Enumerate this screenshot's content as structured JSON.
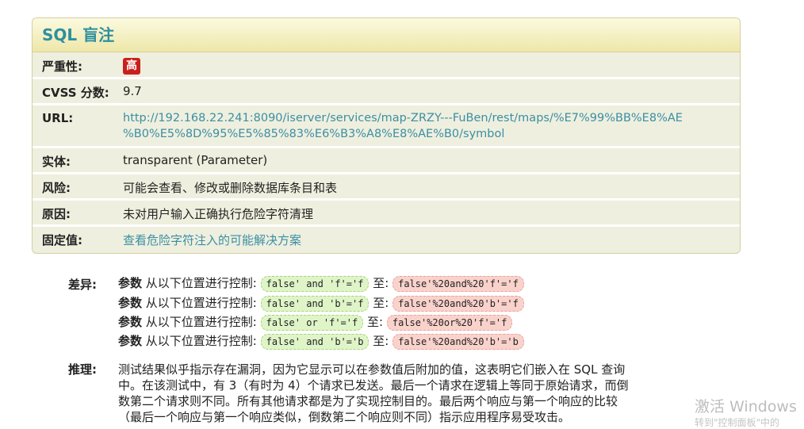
{
  "card": {
    "title": "SQL 盲注",
    "rows": {
      "severity": {
        "label": "严重性:",
        "badge": "高"
      },
      "cvss": {
        "label": "CVSS 分数:",
        "value": "9.7"
      },
      "url": {
        "label": "URL:",
        "line1": "http://192.168.22.241:8090/iserver/services/map-ZRZY---FuBen/rest/maps/%E7%99%BB%E8%AE",
        "line2": "%B0%E5%8D%95%E5%85%83%E6%B3%A8%E8%AE%B0/symbol"
      },
      "entity": {
        "label": "实体:",
        "value": "transparent (Parameter)"
      },
      "risk": {
        "label": "风险:",
        "value": "可能会查看、修改或删除数据库条目和表"
      },
      "cause": {
        "label": "原因:",
        "value": "未对用户输入正确执行危险字符清理"
      },
      "fix": {
        "label": "固定值:",
        "value": "查看危险字符注入的可能解决方案"
      }
    }
  },
  "differences": {
    "label": "差异:",
    "lines": [
      {
        "param": "参数",
        "text": "从以下位置进行控制:",
        "from": "false' and 'f'='f",
        "to_word": "至:",
        "to": "false'%20and%20'f'='f"
      },
      {
        "param": "参数",
        "text": "从以下位置进行控制:",
        "from": "false' and 'b'='f",
        "to_word": "至:",
        "to": "false'%20and%20'b'='f"
      },
      {
        "param": "参数",
        "text": "从以下位置进行控制:",
        "from": "false' or 'f'='f",
        "to_word": "至:",
        "to": "false'%20or%20'f'='f"
      },
      {
        "param": "参数",
        "text": "从以下位置进行控制:",
        "from": "false' and 'b'='b",
        "to_word": "至:",
        "to": "false'%20and%20'b'='b"
      }
    ]
  },
  "reasoning": {
    "label": "推理:",
    "lines": [
      "测试结果似乎指示存在漏洞，因为它显示可以在参数值后附加的值，这表明它们嵌入在 SQL 查询",
      "中。在该测试中，有 3（有时为 4）个请求已发送。最后一个请求在逻辑上等同于原始请求，而倒",
      "数第二个请求则不同。所有其他请求都是为了实现控制目的。最后两个响应与第一个响应的比较",
      "（最后一个响应与第一个响应类似，倒数第二个响应则不同）指示应用程序易受攻击。"
    ]
  },
  "watermark": {
    "line1": "激活 Windows",
    "line2": "转到\"控制面板\"中的"
  }
}
